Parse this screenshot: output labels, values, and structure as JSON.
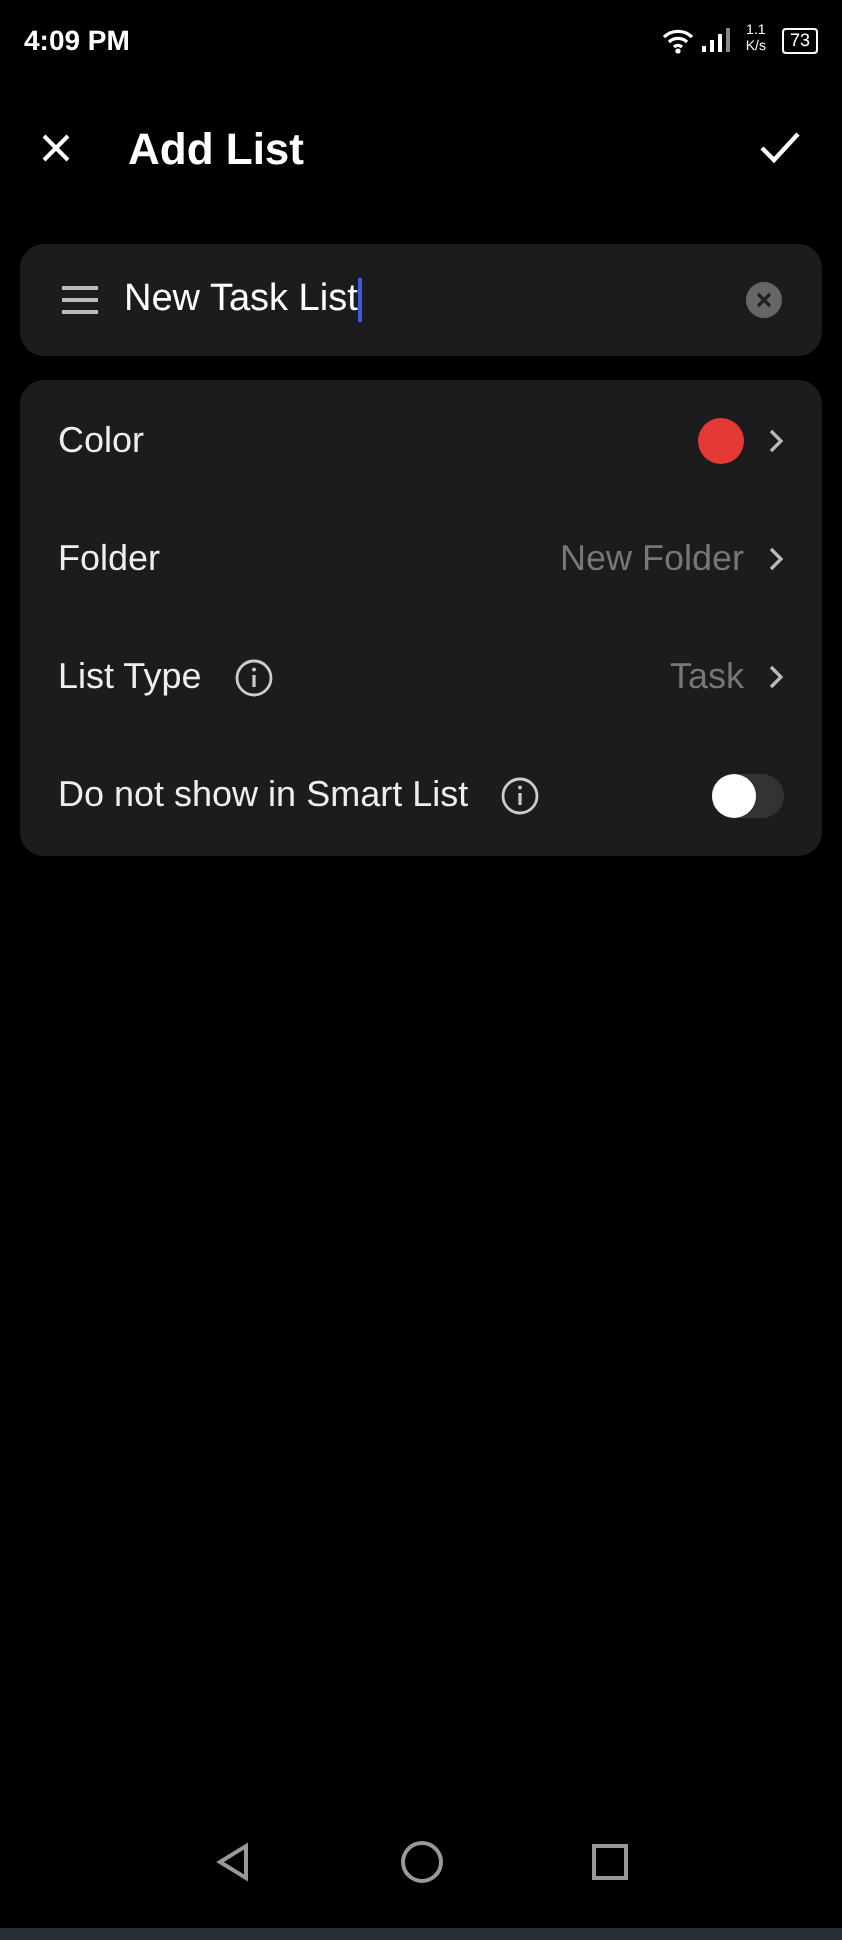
{
  "status_bar": {
    "time": "4:09 PM",
    "speed": "1.1",
    "speed_unit": "K/s",
    "battery": "73"
  },
  "header": {
    "title": "Add List"
  },
  "name_field": {
    "value": "New Task List"
  },
  "settings": [
    {
      "kind": "color",
      "label": "Color",
      "info": false,
      "color": "#e53935"
    },
    {
      "kind": "value",
      "label": "Folder",
      "info": false,
      "value": "New Folder"
    },
    {
      "kind": "value",
      "label": "List Type",
      "info": true,
      "value": "Task"
    },
    {
      "kind": "toggle",
      "label": "Do not show in Smart List",
      "info": true,
      "on": false
    }
  ]
}
